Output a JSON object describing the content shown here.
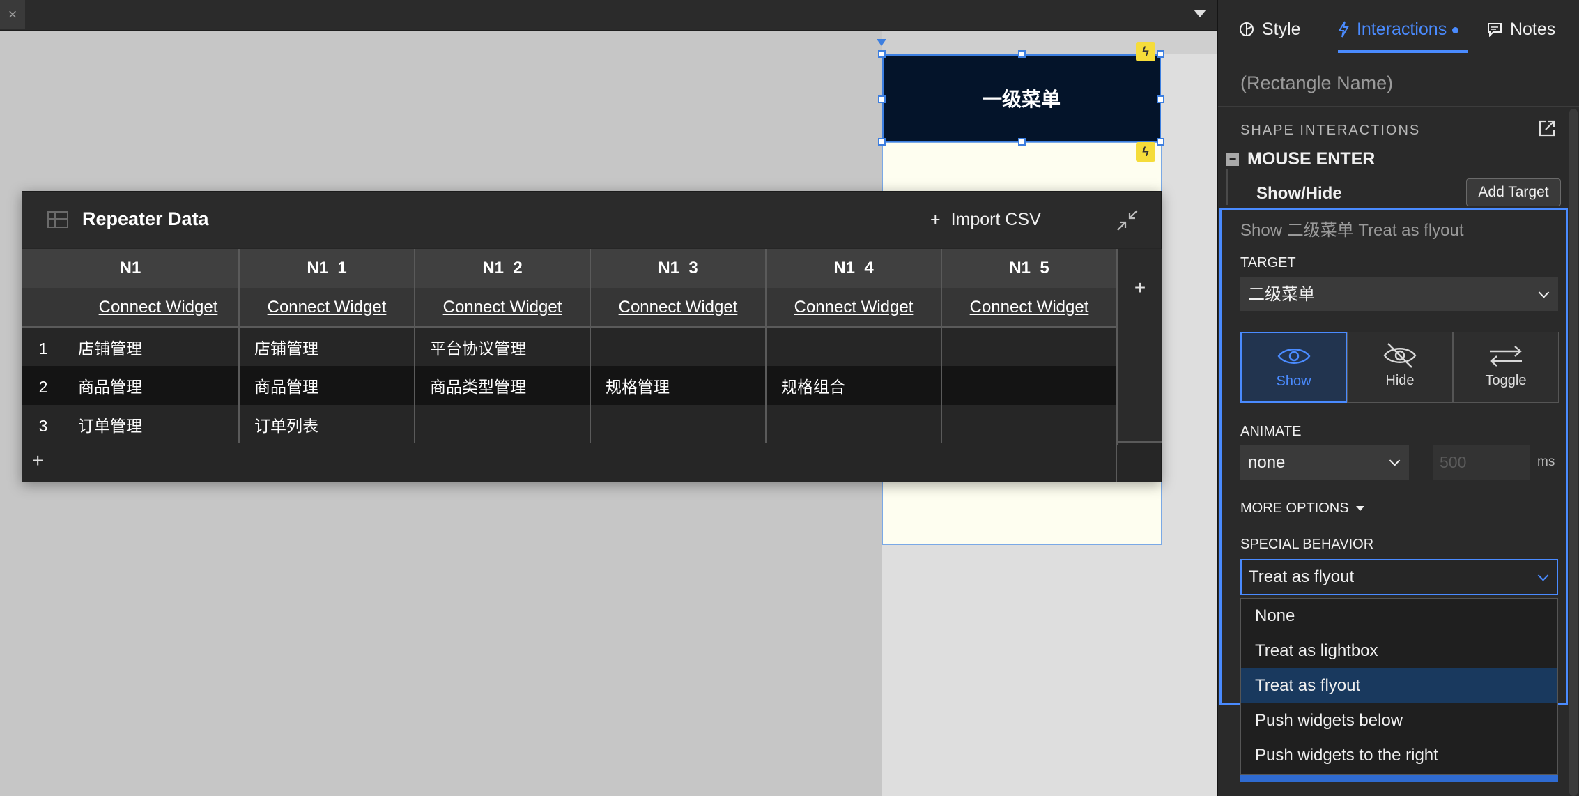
{
  "topbar": {
    "close_glyph": "×"
  },
  "canvas": {
    "menu_widget_text": "一级菜单"
  },
  "repeater": {
    "title": "Repeater Data",
    "import_label": "Import CSV",
    "columns": [
      "N1",
      "N1_1",
      "N1_2",
      "N1_3",
      "N1_4",
      "N1_5"
    ],
    "connect_label": "Connect Widget",
    "rows": [
      {
        "num": "1",
        "cells": [
          "店铺管理",
          "店铺管理",
          "平台协议管理",
          "",
          "",
          ""
        ]
      },
      {
        "num": "2",
        "cells": [
          "商品管理",
          "商品管理",
          "商品类型管理",
          "规格管理",
          "规格组合",
          ""
        ]
      },
      {
        "num": "3",
        "cells": [
          "订单管理",
          "订单列表",
          "",
          "",
          "",
          ""
        ]
      }
    ],
    "add_glyph": "+"
  },
  "inspector": {
    "tabs": {
      "style": "Style",
      "interactions": "Interactions",
      "notes": "Notes"
    },
    "rect_name": "(Rectangle Name)",
    "shape_interactions": "SHAPE INTERACTIONS",
    "event": "MOUSE ENTER",
    "action": "Show/Hide",
    "add_target": "Add Target",
    "action_summary": "Show 二级菜单  Treat as flyout",
    "target_label": "TARGET",
    "target_value": "二级菜单",
    "visibility": {
      "show": "Show",
      "hide": "Hide",
      "toggle": "Toggle",
      "selected": "Show"
    },
    "animate_label": "ANIMATE",
    "animate_value": "none",
    "duration_placeholder": "500",
    "ms_label": "ms",
    "more_options": "MORE OPTIONS",
    "special_label": "SPECIAL BEHAVIOR",
    "special_value": "Treat as flyout",
    "special_options": [
      "None",
      "Treat as lightbox",
      "Treat as flyout",
      "Push widgets below",
      "Push widgets to the right"
    ]
  },
  "colors": {
    "accent": "#4a8bff",
    "widget_bg": "#04142a",
    "flyout_bg": "#fefef0",
    "bolt": "#f5dc3a"
  }
}
